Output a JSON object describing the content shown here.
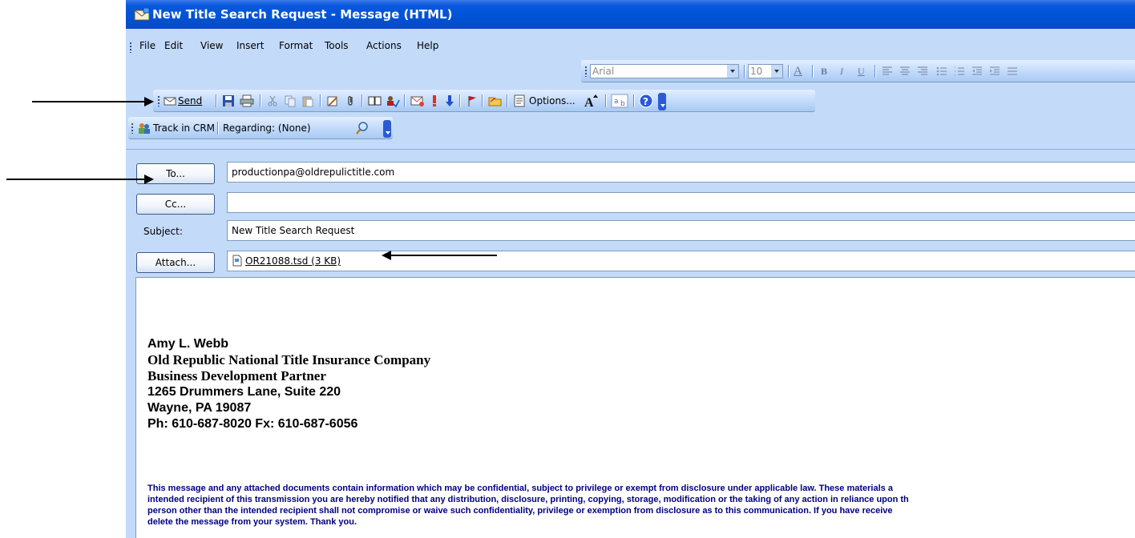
{
  "window": {
    "title": "New Title Search Request - Message (HTML)"
  },
  "menu": [
    "File",
    "Edit",
    "View",
    "Insert",
    "Format",
    "Tools",
    "Actions",
    "Help"
  ],
  "format_toolbar": {
    "font": "Arial",
    "size": "10",
    "bold": "B",
    "italic": "I",
    "underline": "U"
  },
  "standard_toolbar": {
    "send": "Send",
    "options": "Options..."
  },
  "crm_toolbar": {
    "track": "Track in CRM",
    "regarding": "Regarding: (None)"
  },
  "header": {
    "to_button": "To...",
    "to_value": "productionpa@oldrepulictitle.com",
    "cc_button": "Cc...",
    "cc_value": "",
    "subject_label": "Subject:",
    "subject_value": "New Title Search Request",
    "attach_button": "Attach...",
    "attachment": "OR21088.tsd (3 KB)"
  },
  "signature": [
    "Amy L. Webb",
    "Old Republic National Title Insurance Company",
    "Business Development Partner",
    "1265 Drummers Lane, Suite 220",
    "Wayne, PA 19087",
    "Ph: 610-687-8020 Fx: 610-687-6056"
  ],
  "disclaimer": [
    "This message and any attached documents contain information which may be confidential, subject to privilege or exempt from disclosure under applicable law.  These materials a",
    "intended recipient of this transmission you are hereby notified that any distribution, disclosure, printing, copying, storage, modification or the taking of any action in reliance upon th",
    "person other than the intended recipient shall not compromise or waive such confidentiality, privilege or exemption from disclosure as to this communication. If you have receive",
    "delete the message from your system. Thank you."
  ],
  "colors": {
    "titlebar": "#0052d6",
    "chrome": "#c3daf9",
    "disclaimer_text": "#000080"
  }
}
